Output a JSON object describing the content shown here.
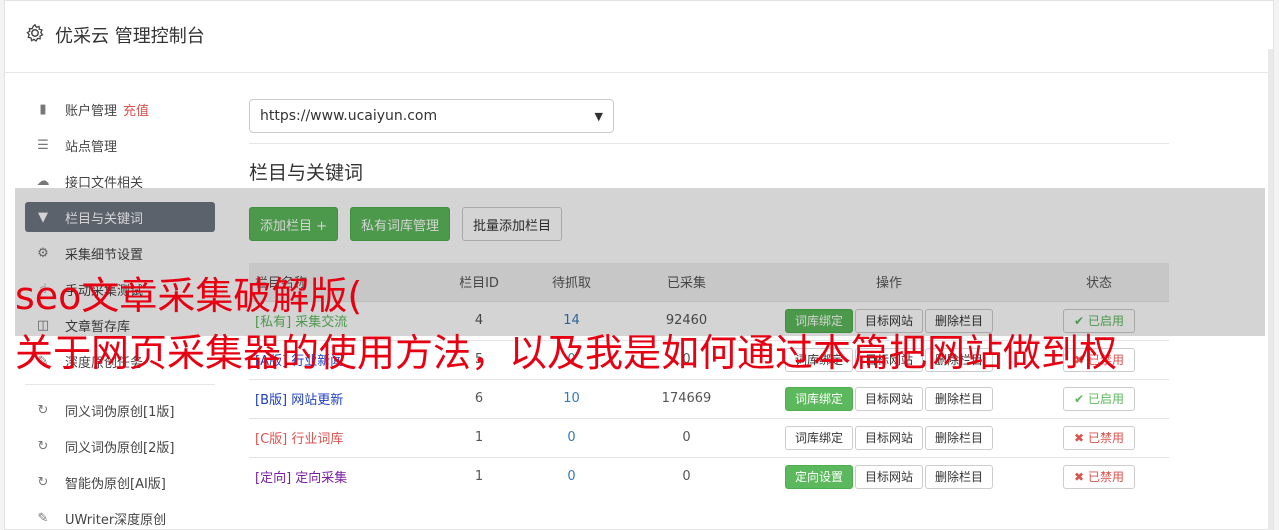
{
  "header": {
    "title": "优采云 管理控制台"
  },
  "sidebar": {
    "items": [
      {
        "label": "账户管理",
        "accent": "充值",
        "icon": "bar-chart-icon"
      },
      {
        "label": "站点管理",
        "icon": "server-icon"
      },
      {
        "label": "接口文件相关",
        "icon": "cloud-upload-icon"
      },
      {
        "label": "栏目与关键词",
        "icon": "filter-icon",
        "active": true
      },
      {
        "label": "采集细节设置",
        "icon": "gears-icon"
      },
      {
        "label": "手动采集测试",
        "icon": "hand-icon"
      },
      {
        "label": "文章暂存库",
        "icon": "database-icon"
      },
      {
        "label": "深度原创任务",
        "icon": "edit-icon"
      }
    ],
    "items2": [
      {
        "label": "同义词伪原创[1版]",
        "icon": "refresh-icon"
      },
      {
        "label": "同义词伪原创[2版]",
        "icon": "refresh-icon"
      },
      {
        "label": "智能伪原创[AI版]",
        "icon": "refresh-icon"
      },
      {
        "label": "UWriter深度原创",
        "icon": "edit-icon"
      }
    ]
  },
  "main": {
    "site_select": "https://www.ucaiyun.com",
    "section_title": "栏目与关键词",
    "buttons": {
      "add": "添加栏目 +",
      "private_lib": "私有词库管理",
      "batch_add": "批量添加栏目"
    },
    "table": {
      "headers": [
        "栏目名称",
        "栏目ID",
        "待抓取",
        "已采集",
        "操作",
        "状态"
      ],
      "rows": [
        {
          "tag": "[私有]",
          "name": "采集交流",
          "tagClass": "tag-green",
          "id": "4",
          "pending": "14",
          "collected": "92460",
          "action1": "词库绑定",
          "action1Green": true,
          "status": "已启用",
          "statusOn": true
        },
        {
          "tag": "[A版]",
          "name": "行业新闻",
          "tagClass": "tag-blue",
          "id": "5",
          "pending": "0",
          "collected": "0",
          "action1": "词库绑定",
          "action1Green": false,
          "status": "已禁用",
          "statusOn": false
        },
        {
          "tag": "[B版]",
          "name": "网站更新",
          "tagClass": "tag-blue",
          "id": "6",
          "pending": "10",
          "collected": "174669",
          "action1": "词库绑定",
          "action1Green": true,
          "status": "已启用",
          "statusOn": true
        },
        {
          "tag": "[C版]",
          "name": "行业词库",
          "tagClass": "tag-red",
          "id": "1",
          "pending": "0",
          "collected": "0",
          "action1": "词库绑定",
          "action1Green": false,
          "status": "已禁用",
          "statusOn": false
        },
        {
          "tag": "[定向]",
          "name": "定向采集",
          "tagClass": "tag-purple",
          "id": "1",
          "pending": "0",
          "collected": "0",
          "action1": "定向设置",
          "action1Green": true,
          "status": "已禁用",
          "statusOn": false
        }
      ],
      "action2": "目标网站",
      "action3": "删除栏目"
    }
  },
  "overlay": {
    "line1": "seo文章采集破解版(",
    "line2": "关于网页采集器的使用方法，以及我是如何通过本篇把网站做到权"
  }
}
